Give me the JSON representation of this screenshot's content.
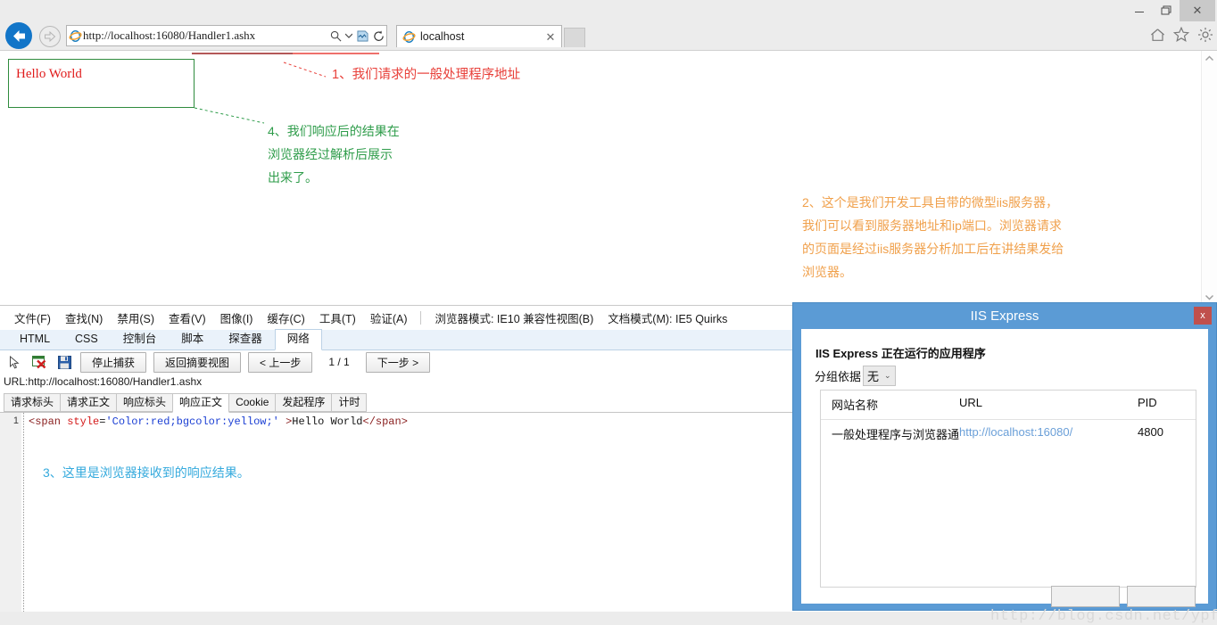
{
  "window": {
    "minimize_label": "minimize",
    "maximize_label": "restore",
    "close_label": "✕"
  },
  "browser": {
    "back_label": "back",
    "forward_label": "forward",
    "address_value": "http://localhost:16080/Handler1.ashx",
    "address_placeholder": "",
    "search_icon": "search-icon",
    "dropdown_icon": "chevron-down-icon",
    "compat_icon": "compatibility-view-icon",
    "refresh_icon": "refresh-icon",
    "tab_title": "localhost",
    "tab_close_label": "✕",
    "new_tab_label": "",
    "home_icon": "home-icon",
    "favorites_icon": "star-icon",
    "tools_icon": "gear-icon"
  },
  "page": {
    "hello_text": "Hello World",
    "annotation1": "1、我们请求的一般处理程序地址",
    "annotation4_lines": [
      "4、我们响应后的结果在",
      "浏览器经过解析后展示",
      "出来了。"
    ],
    "annotation2_lines": [
      "2、这个是我们开发工具自带的微型iis服务器，",
      "我们可以看到服务器地址和ip端口。浏览器请求",
      "的页面是经过iis服务器分析加工后在讲结果发给",
      "浏览器。"
    ],
    "colors": {
      "hello_text": "#e01b1b",
      "hello_border": "#2e8b3d",
      "annotation1": "#e8403a",
      "annotation4": "#2e9c4a",
      "annotation2": "#f0a04b",
      "annotation3": "#35aadd"
    }
  },
  "devtools": {
    "menus": [
      "文件(F)",
      "查找(N)",
      "禁用(S)",
      "查看(V)",
      "图像(I)",
      "缓存(C)",
      "工具(T)",
      "验证(A)"
    ],
    "browser_mode": "浏览器模式: IE10 兼容性视图(B)",
    "document_mode": "文档模式(M): IE5 Quirks",
    "tabs": [
      {
        "label": "HTML",
        "selected": false
      },
      {
        "label": "CSS",
        "selected": false
      },
      {
        "label": "控制台",
        "selected": false
      },
      {
        "label": "脚本",
        "selected": false
      },
      {
        "label": "探查器",
        "selected": false
      },
      {
        "label": "网络",
        "selected": true
      }
    ],
    "toolbar": {
      "select_icon": "cursor-arrow-icon",
      "clear_icon": "clear-entries-icon",
      "save_icon": "save-floppy-icon",
      "stop_capture": "停止捕获",
      "back_to_summary": "返回摘要视图",
      "prev_step": "< 上一步",
      "page_indicator": "1 / 1",
      "next_step": "下一步 >"
    },
    "url_line": "URL:http://localhost:16080/Handler1.ashx",
    "subtabs": [
      {
        "label": "请求标头",
        "selected": false
      },
      {
        "label": "请求正文",
        "selected": false
      },
      {
        "label": "响应标头",
        "selected": false
      },
      {
        "label": "响应正文",
        "selected": true
      },
      {
        "label": "Cookie",
        "selected": false
      },
      {
        "label": "发起程序",
        "selected": false
      },
      {
        "label": "计时",
        "selected": false
      }
    ],
    "code": {
      "line_number": "1",
      "tag_open": "<span",
      "attr_name": " style",
      "equals": "=",
      "attr_value": "'Color:red;bgcolor:yellow;'",
      "tag_close_open": " >",
      "text": "Hello World",
      "tag_end": "</span>"
    },
    "annotation3": "3、这里是浏览器接收到的响应结果。"
  },
  "iis": {
    "title": "IIS Express",
    "close_label": "x",
    "heading": "IIS Express 正在运行的应用程序",
    "group_label": "分组依据",
    "group_value": "无",
    "columns": [
      "网站名称",
      "URL",
      "PID"
    ],
    "rows": [
      {
        "name": "一般处理程序与浏览器通信",
        "url": "http://localhost:16080/",
        "pid": "4800"
      }
    ],
    "watermark": "http://blog.csdn.net/ypfnet"
  }
}
